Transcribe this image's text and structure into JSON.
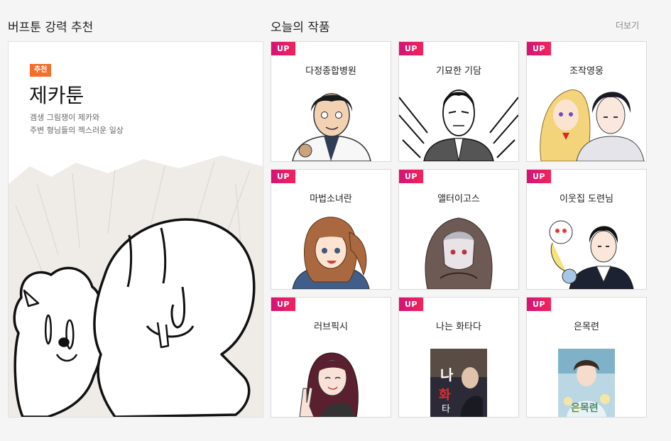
{
  "featured": {
    "section_title": "버프툰 강력 추천",
    "badge": "추천",
    "name": "제카툰",
    "description": [
      "겜생 그림쟁이 제카와",
      "주변 형님들의 젝스러운 일상"
    ],
    "thumbnail_icon": "cartoon-characters"
  },
  "today": {
    "section_title": "오늘의 작품",
    "more_label": "더보기",
    "up_label": "UP",
    "up_color": "#e8176a",
    "cards": [
      {
        "title": "다정종합병원",
        "thumbnail_icon": "doctor-character"
      },
      {
        "title": "기묘한 기담",
        "thumbnail_icon": "ink-man-character"
      },
      {
        "title": "조작영웅",
        "thumbnail_icon": "hero-duo-characters"
      },
      {
        "title": "마법소녀란",
        "thumbnail_icon": "magical-girl-character"
      },
      {
        "title": "앨터이고스",
        "thumbnail_icon": "hooded-character"
      },
      {
        "title": "이웃집 도련님",
        "thumbnail_icon": "neighbor-boy-character"
      },
      {
        "title": "러브픽시",
        "thumbnail_icon": "peace-sign-girl-character"
      },
      {
        "title": "나는 화타다",
        "thumbnail_icon": "book-cover"
      },
      {
        "title": "은목련",
        "thumbnail_icon": "book-cover"
      }
    ]
  }
}
